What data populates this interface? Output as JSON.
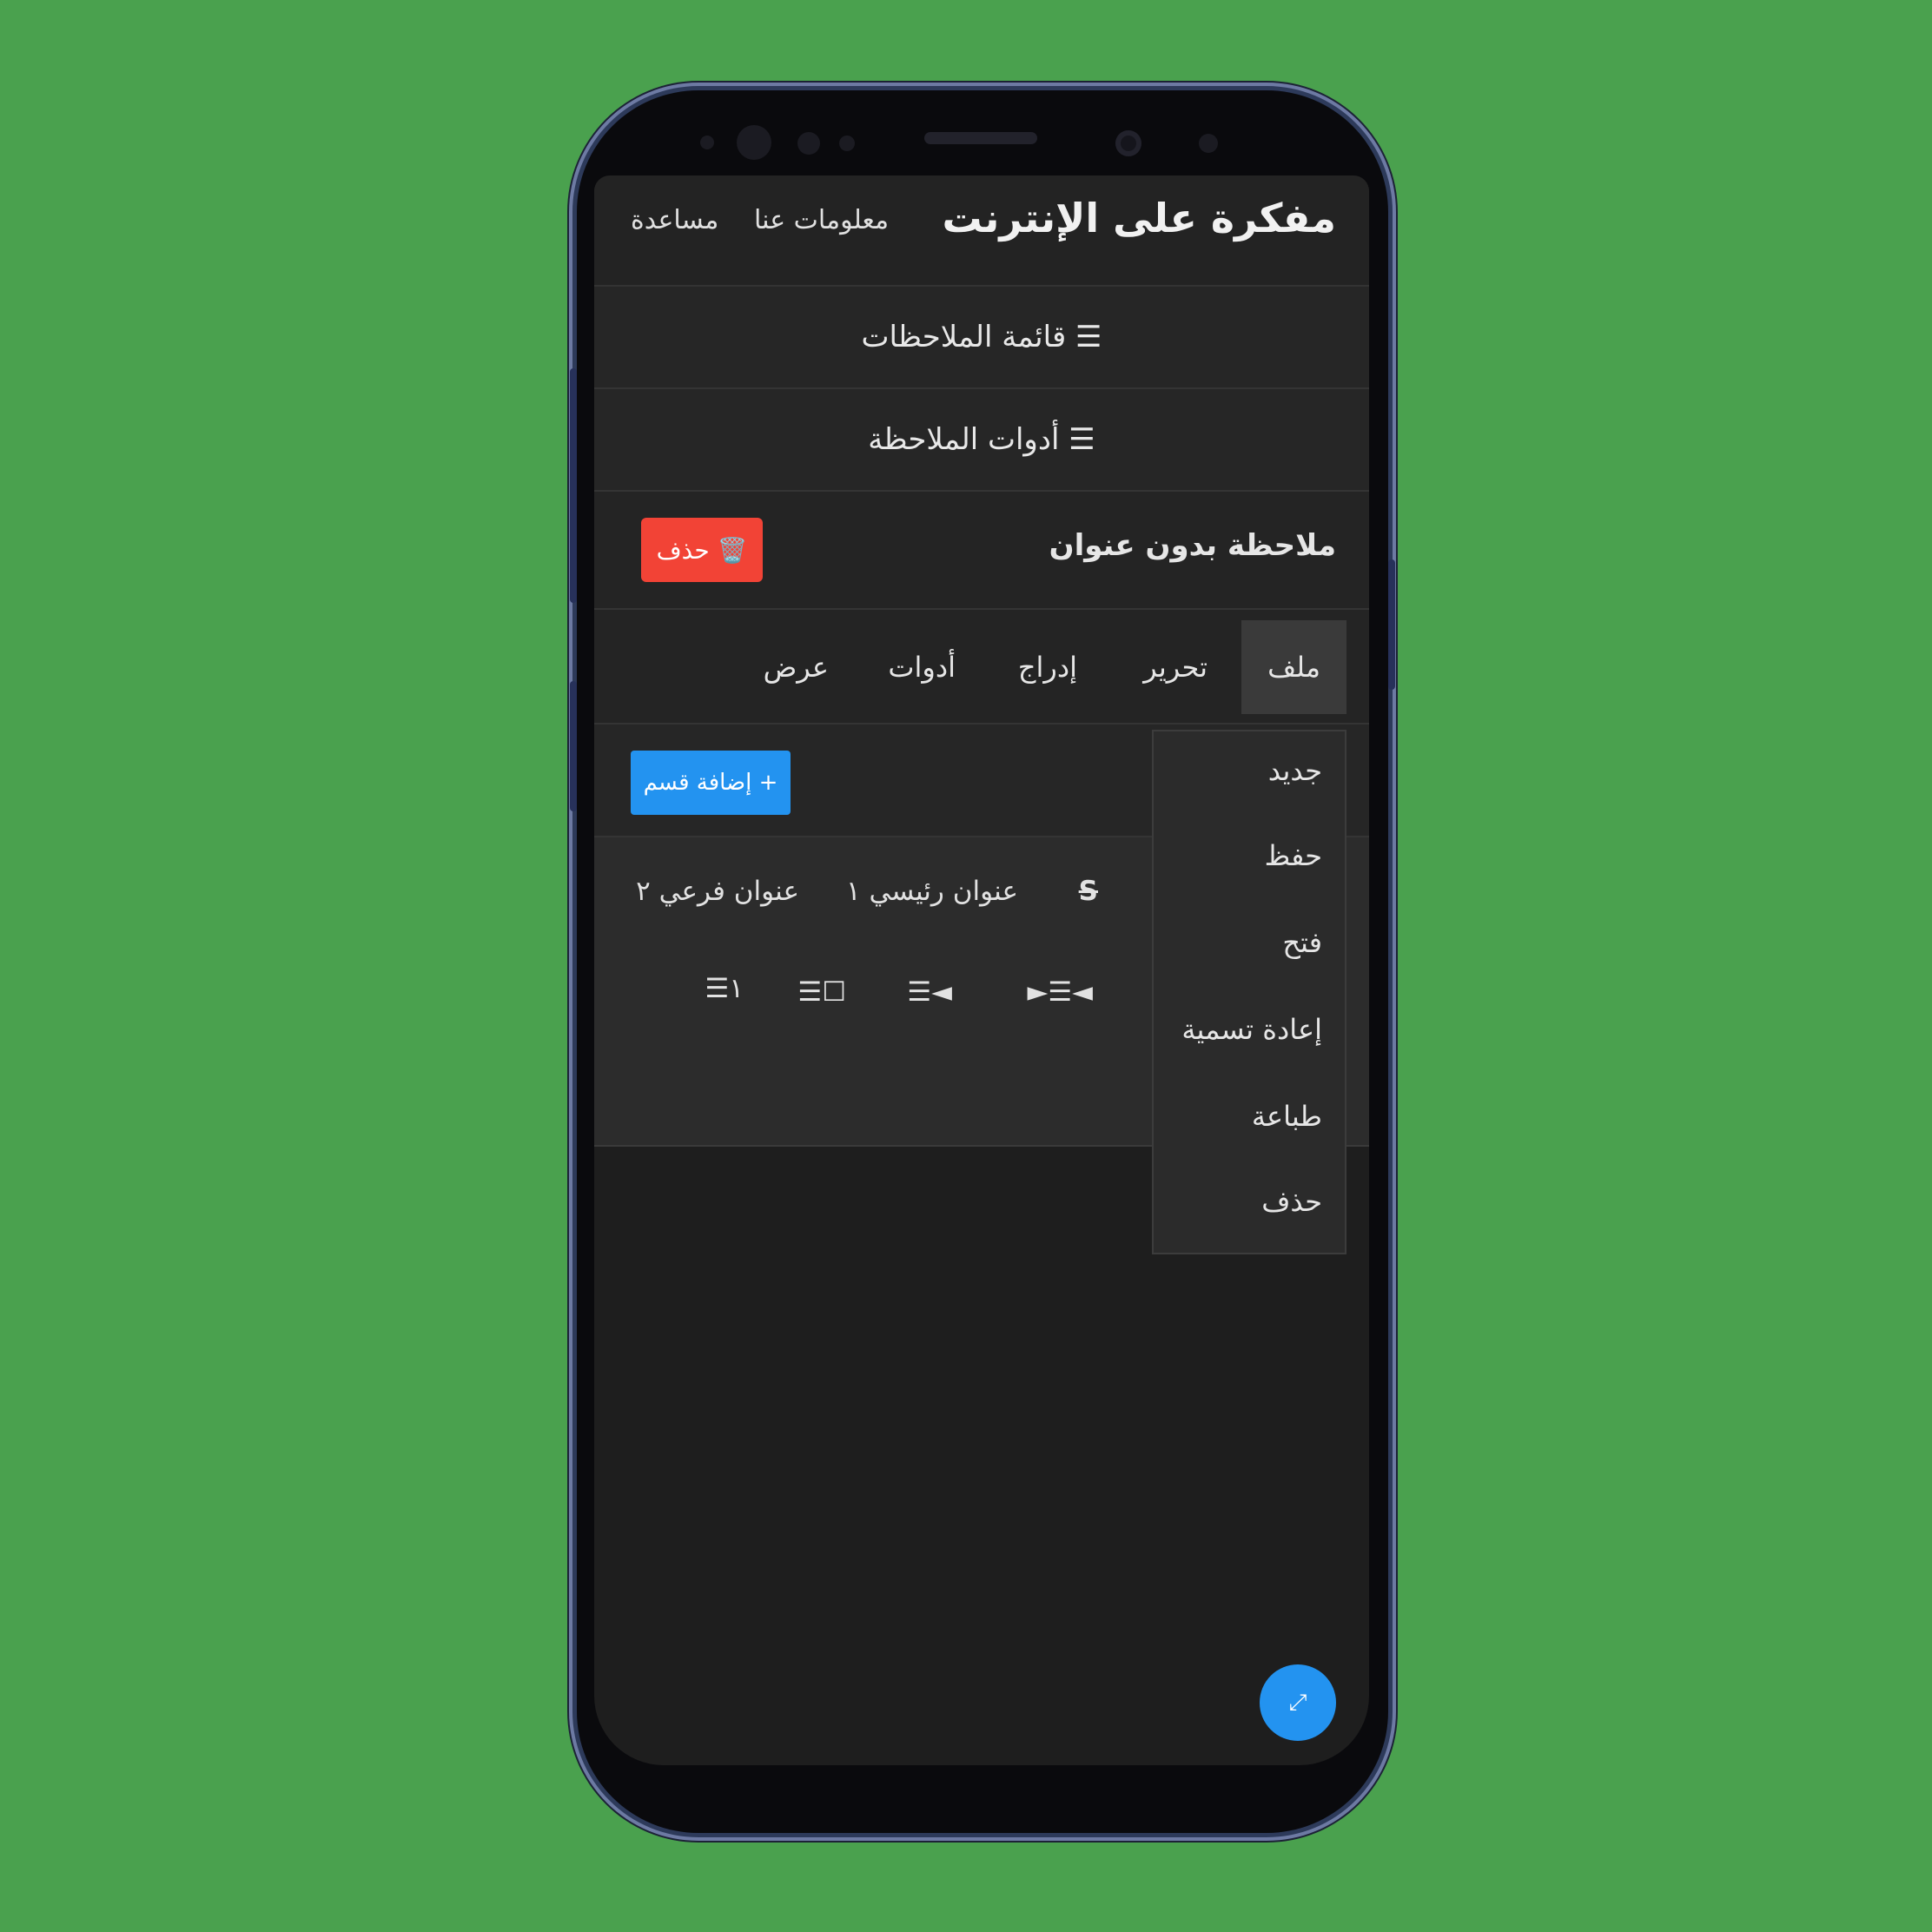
{
  "header": {
    "title": "مفكرة على الإنترنت",
    "about_label": "معلومات عنا",
    "help_label": "مساعدة"
  },
  "notes_list_label": "☰ قائمة الملاحظات",
  "note_tools_label": "☰ أدوات الملاحظة",
  "note": {
    "title": "ملاحظة بدون عنوان",
    "delete_label": "🗑️ حذف"
  },
  "menubar": {
    "items": [
      "ملف",
      "تحرير",
      "إدراج",
      "أدوات",
      "عرض"
    ],
    "active": "ملف"
  },
  "file_menu": {
    "items": [
      "جديد",
      "حفظ",
      "فتح",
      "إعادة تسمية",
      "طباعة",
      "حذف"
    ]
  },
  "add_section_label": "+ إضافة قسم",
  "formatting": {
    "strike": "S",
    "heading1": "عنوان رئيسي ١",
    "heading2": "عنوان فرعي ٢",
    "ltr_rtl": "◄☰►",
    "indent": "◄☰",
    "checklist": "☐☰",
    "numbered": "١☰"
  },
  "fab_icon": "⤢",
  "colors": {
    "background": "#4aa14e",
    "danger": "#f24336",
    "primary": "#2393f0"
  }
}
